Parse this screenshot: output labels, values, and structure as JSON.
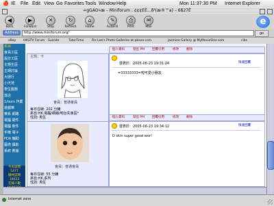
{
  "menubar": {
    "items": [
      "IE",
      "File",
      "Edit",
      "View",
      "Go",
      "Favorites",
      "Tools",
      "Window",
      "Help"
    ],
    "clock": "Mon 11:37:30 PM",
    "app_name": "Internet Explorer"
  },
  "window": {
    "title": "=gGAO»æ – Miniforum : ¢¢¢EÉ...ð³(æ®™a) – 6ß27Ê"
  },
  "toolbar": {
    "buttons": [
      {
        "label": "Back",
        "icon": "◀"
      },
      {
        "label": "Forward",
        "icon": "▶"
      },
      {
        "label": "Stop",
        "icon": "✕"
      },
      {
        "label": "Refresh",
        "icon": "↻"
      },
      {
        "label": "Home",
        "icon": "⌂"
      },
      {
        "label": "AutoFill",
        "icon": "✎"
      },
      {
        "label": "Print",
        "icon": "⎙"
      },
      {
        "label": "Mail",
        "icon": "✉"
      }
    ]
  },
  "address": {
    "label": "Address",
    "value": "http://www.miniforum.org/",
    "go": "go"
  },
  "favorites": [
    "eBay",
    "HKGTV Forum",
    "Suicide",
    "TutorTime",
    "Ris Lee's Photo Galleries at pbase.com",
    "Jasmine Gallery @ MyMovieStar.com",
    "cibs"
  ],
  "nav": {
    "top": "本目",
    "items": [
      "會員工區",
      "設計工區",
      "主題生區",
      "主期討論",
      "大朋行",
      "小天地",
      "學生服務",
      "首店",
      "1/ours 作業",
      "遊戲樂",
      "樂系 網路",
      "電腦 硬件",
      "電腦 軟件",
      "手機 電子",
      "PDA 輔助",
      "藝術 攝影",
      "系統 數據"
    ],
    "counter": [
      "今天訪問",
      "5477",
      "總共訪問",
      "18023",
      "在線人數",
      "8586190",
      "Yes 1.0"
    ]
  },
  "posts": [
    {
      "user_title": "主題：卡",
      "level": "會員：普通會員",
      "stats": [
        "每日在線: 202 分鐘",
        "來自:HK,電腦/網絡/吧台先會區*",
        "性別: 男生"
      ],
      "actions": [
        "個人資料",
        "發出 PM",
        "回覆引用",
        "修改",
        "刪除"
      ],
      "posted_label": "發表於:",
      "posted_time": "2005-06-23 19:31:24",
      "quick_reply": "快速回覆",
      "body": "=33333333=啦可愛小朋友"
    },
    {
      "user_title": "",
      "level": "會員：普通會員",
      "stats": [
        "每日在線: 55 分鐘",
        "來自:HK,系列",
        "性別: 男生"
      ],
      "actions": [
        "個人資料",
        "發出 PM",
        "回覆引用",
        "修改",
        "刪除"
      ],
      "posted_label": "發表於:",
      "posted_time": "2005-06-23 19:34:12",
      "quick_reply": "快速回覆",
      "body": "D skin super good wor!"
    }
  ],
  "status": {
    "text": "Internet zone"
  },
  "colors": {
    "nav_bg": "#1e6fa8",
    "post_border": "#9fa6d8",
    "action_text": "#a00000",
    "ie_blue": "#2a6ad0"
  }
}
